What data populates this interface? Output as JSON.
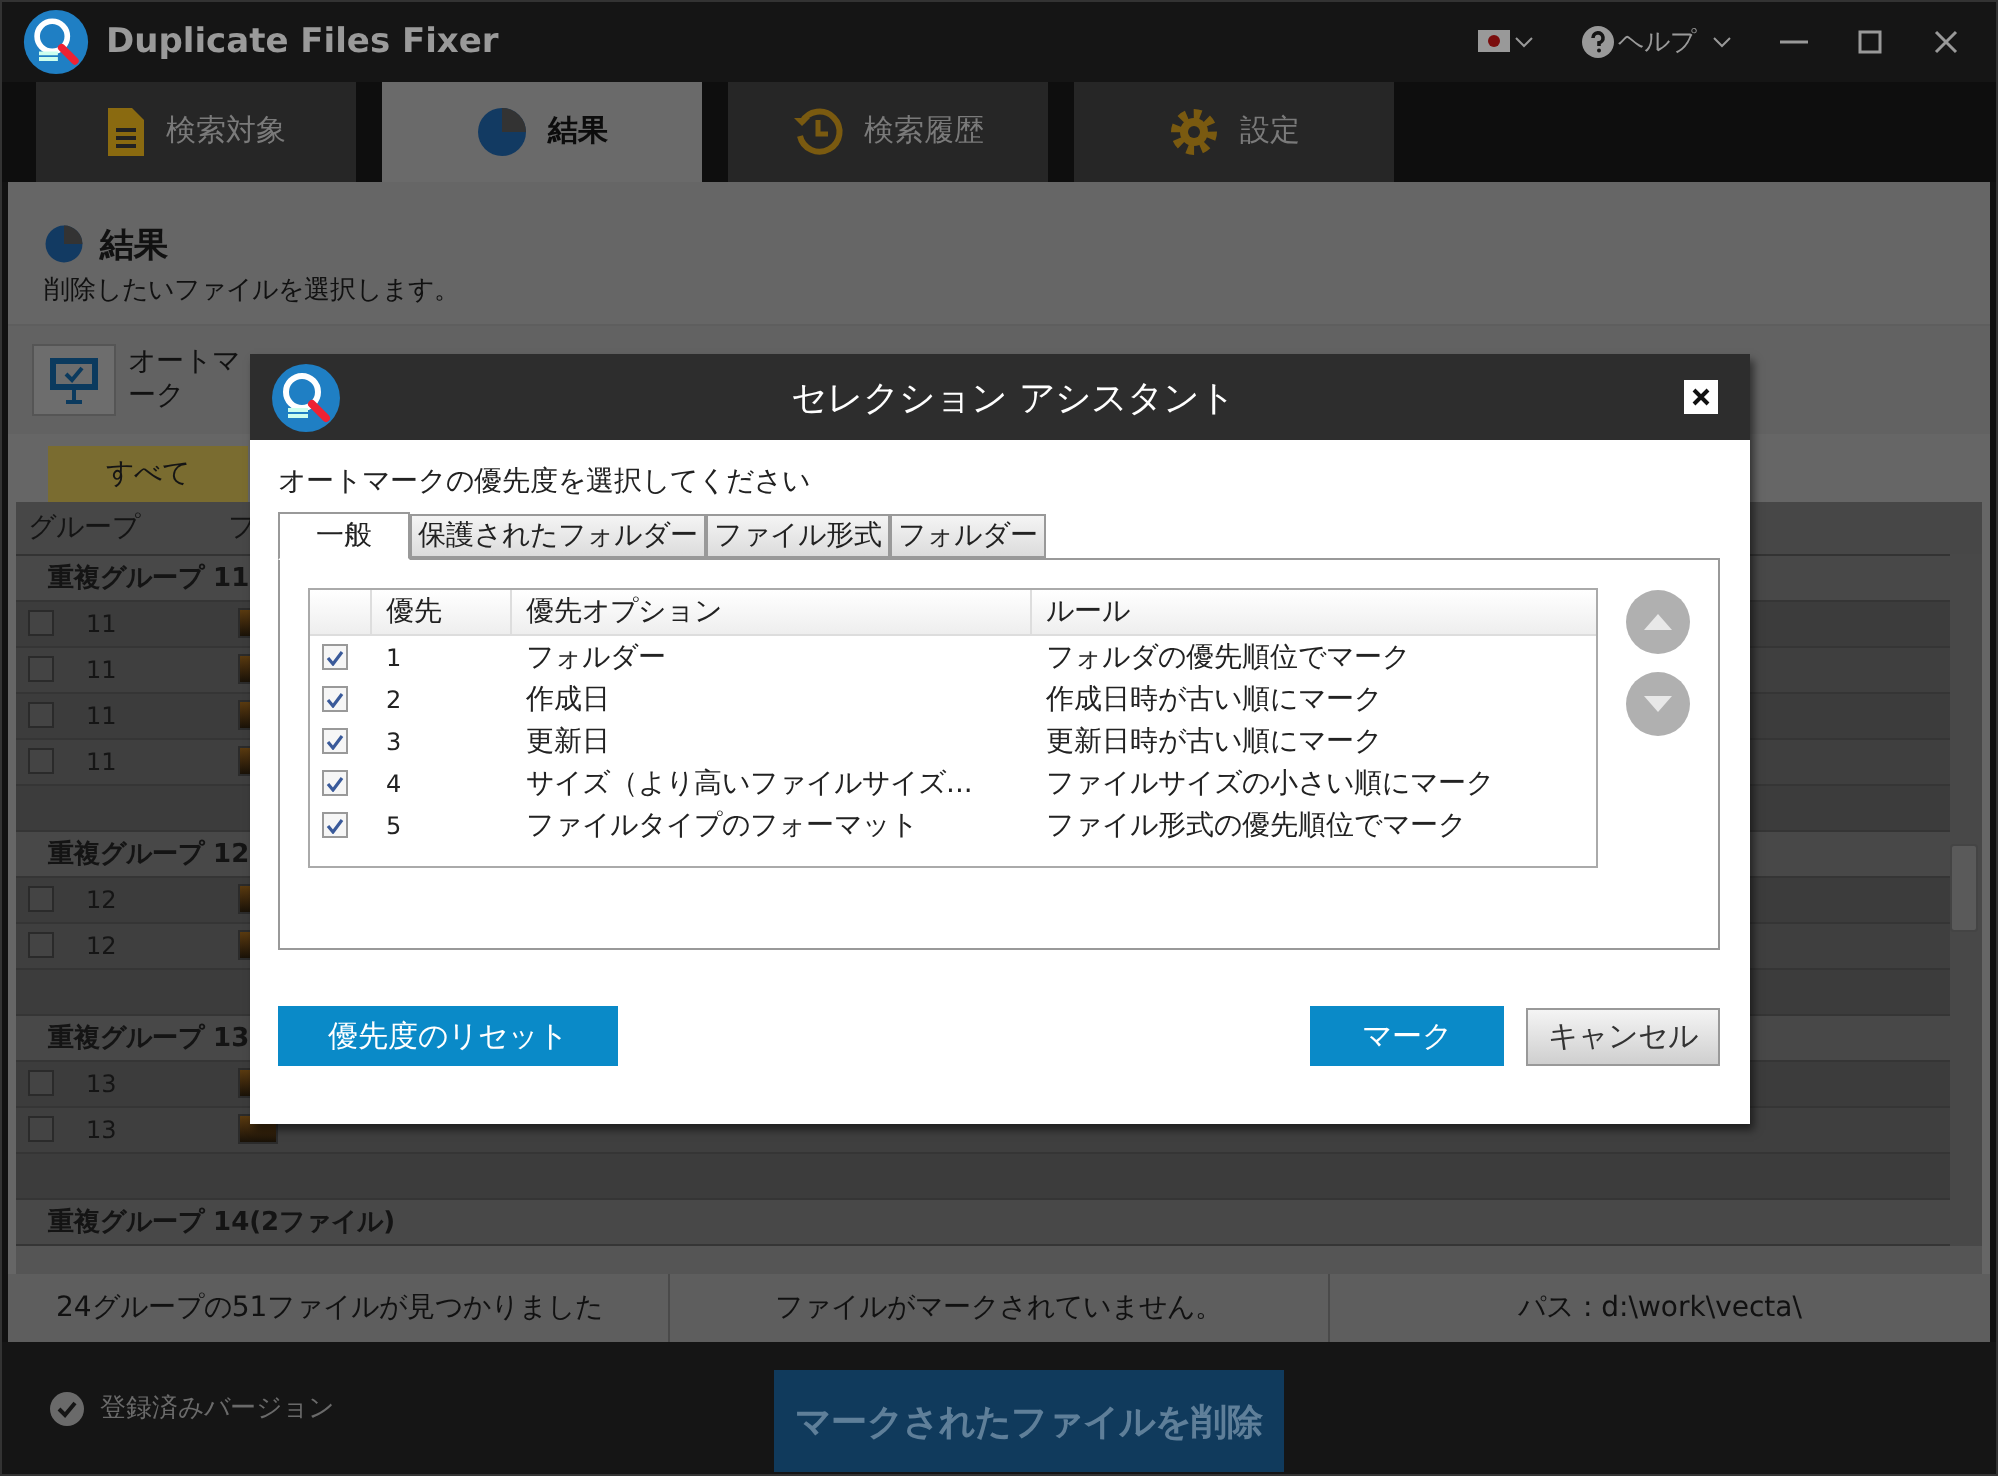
{
  "window": {
    "title": "Duplicate Files Fixer",
    "help": "ヘルプ"
  },
  "tabs": [
    {
      "label": "検索対象",
      "selected": false
    },
    {
      "label": "結果",
      "selected": true
    },
    {
      "label": "検索履歴",
      "selected": false
    },
    {
      "label": "設定",
      "selected": false
    }
  ],
  "header": {
    "title": "結果",
    "subtitle": "削除したいファイルを選択します。"
  },
  "toolbar": {
    "automark": "オートマーク"
  },
  "filter_tabs": [
    {
      "label": "すべて",
      "selected": true
    }
  ],
  "table": {
    "columns": [
      "グループ",
      "フ"
    ],
    "groups": [
      {
        "label": "重複グループ 11",
        "rows": [
          {
            "group": "11",
            "checked": false
          },
          {
            "group": "11",
            "checked": false
          },
          {
            "group": "11",
            "checked": false
          },
          {
            "group": "11",
            "checked": false
          }
        ]
      },
      {
        "label": "重複グループ 12",
        "rows": [
          {
            "group": "12",
            "checked": false
          },
          {
            "group": "12",
            "checked": false
          }
        ]
      },
      {
        "label": "重複グループ 13",
        "rows": [
          {
            "group": "13",
            "checked": false
          },
          {
            "group": "13",
            "checked": false
          }
        ]
      },
      {
        "label": "重複グループ 14(2ファイル)"
      }
    ]
  },
  "status_bar": [
    "24グループの51ファイルが見つかりました",
    "ファイルがマークされていません。",
    "パス : d:\\work\\vecta\\"
  ],
  "footer": {
    "registered": "登録済みバージョン",
    "delete_button": "マークされたファイルを削除"
  },
  "dialog": {
    "title": "セレクション アシスタント",
    "prompt": "オートマークの優先度を選択してください",
    "tabs": [
      {
        "label": "一般",
        "selected": true
      },
      {
        "label": "保護されたフォルダー",
        "selected": false
      },
      {
        "label": "ファイル形式",
        "selected": false
      },
      {
        "label": "フォルダー",
        "selected": false
      }
    ],
    "columns": [
      "優先",
      "優先オプション",
      "ルール"
    ],
    "rows": [
      {
        "checked": true,
        "priority": "1",
        "option": "フォルダー",
        "rule": "フォルダの優先順位でマーク"
      },
      {
        "checked": true,
        "priority": "2",
        "option": "作成日",
        "rule": "作成日時が古い順にマーク"
      },
      {
        "checked": true,
        "priority": "3",
        "option": "更新日",
        "rule": "更新日時が古い順にマーク"
      },
      {
        "checked": true,
        "priority": "4",
        "option": "サイズ（より高いファイルサイズ...",
        "rule": "ファイルサイズの小さい順にマーク"
      },
      {
        "checked": true,
        "priority": "5",
        "option": "ファイルタイプのフォーマット",
        "rule": "ファイル形式の優先順位でマーク"
      }
    ],
    "buttons": {
      "reset": "優先度のリセット",
      "mark": "マーク",
      "cancel": "キャンセル"
    }
  }
}
